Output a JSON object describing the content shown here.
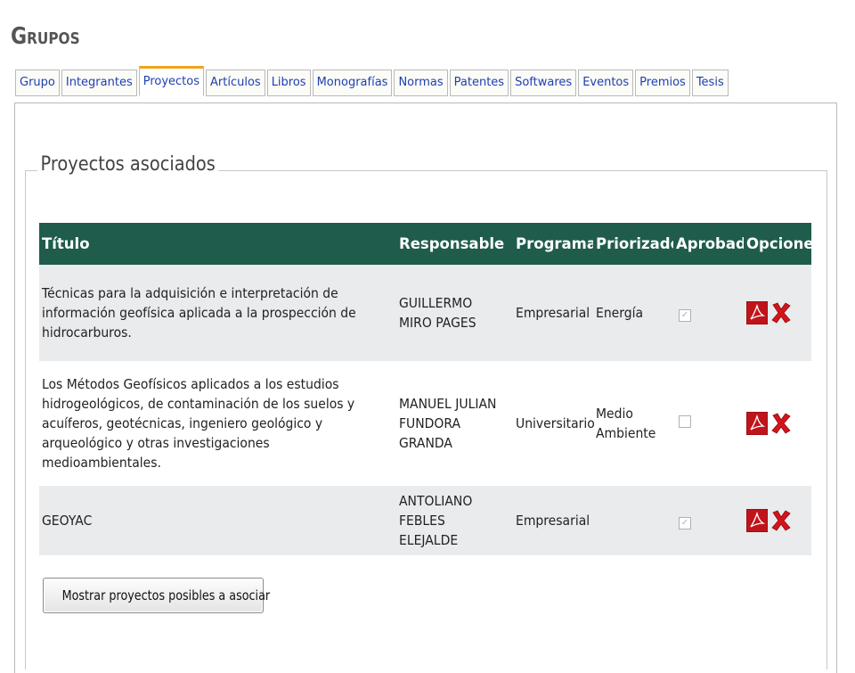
{
  "page_title": "Grupos",
  "tabs": [
    {
      "label": "Grupo",
      "active": false
    },
    {
      "label": "Integrantes",
      "active": false
    },
    {
      "label": "Proyectos",
      "active": true
    },
    {
      "label": "Artículos",
      "active": false
    },
    {
      "label": "Libros",
      "active": false
    },
    {
      "label": "Monografías",
      "active": false
    },
    {
      "label": "Normas",
      "active": false
    },
    {
      "label": "Patentes",
      "active": false
    },
    {
      "label": "Softwares",
      "active": false
    },
    {
      "label": "Eventos",
      "active": false
    },
    {
      "label": "Premios",
      "active": false
    },
    {
      "label": "Tesis",
      "active": false
    }
  ],
  "section": {
    "legend": "Proyectos asociados"
  },
  "table": {
    "headers": {
      "titulo": "Título",
      "responsable": "Responsable",
      "programa": "Programa",
      "priorizado": "Priorizado",
      "aprobado": "Aprobado",
      "opciones": "Opciones"
    },
    "rows": [
      {
        "titulo": "Técnicas para la adquisición e interpretación de información geofísica aplicada a la prospección de hidrocarburos.",
        "responsable": "GUILLERMO MIRO PAGES",
        "programa": "Empresarial",
        "priorizado": "Energía",
        "aprobado": true
      },
      {
        "titulo": "Los Métodos Geofísicos aplicados a los estudios hidrogeológicos, de contaminación de los suelos y acuíferos, geotécnicas, ingeniero geológico y arqueológico y otras investigaciones medioambientales.",
        "responsable": "MANUEL JULIAN FUNDORA GRANDA",
        "programa": "Universitario",
        "priorizado": "Medio Ambiente",
        "aprobado": false
      },
      {
        "titulo": "GEOYAC",
        "responsable": "ANTOLIANO FEBLES ELEJALDE",
        "programa": "Empresarial",
        "priorizado": "",
        "aprobado": true
      }
    ]
  },
  "actions": {
    "show_possible_label": "Mostrar proyectos posibles a asociar"
  },
  "icons": {
    "pdf": "pdf-icon",
    "delete": "delete-x-icon",
    "checkbox": "checkbox-icon"
  },
  "colors": {
    "header_bg": "#1f5c4c",
    "active_tab_accent": "#f2a21d",
    "tab_link": "#1f3fb0",
    "row_alt": "#e9ebec",
    "pdf_red": "#c0141b",
    "delete_red": "#d4141b"
  }
}
